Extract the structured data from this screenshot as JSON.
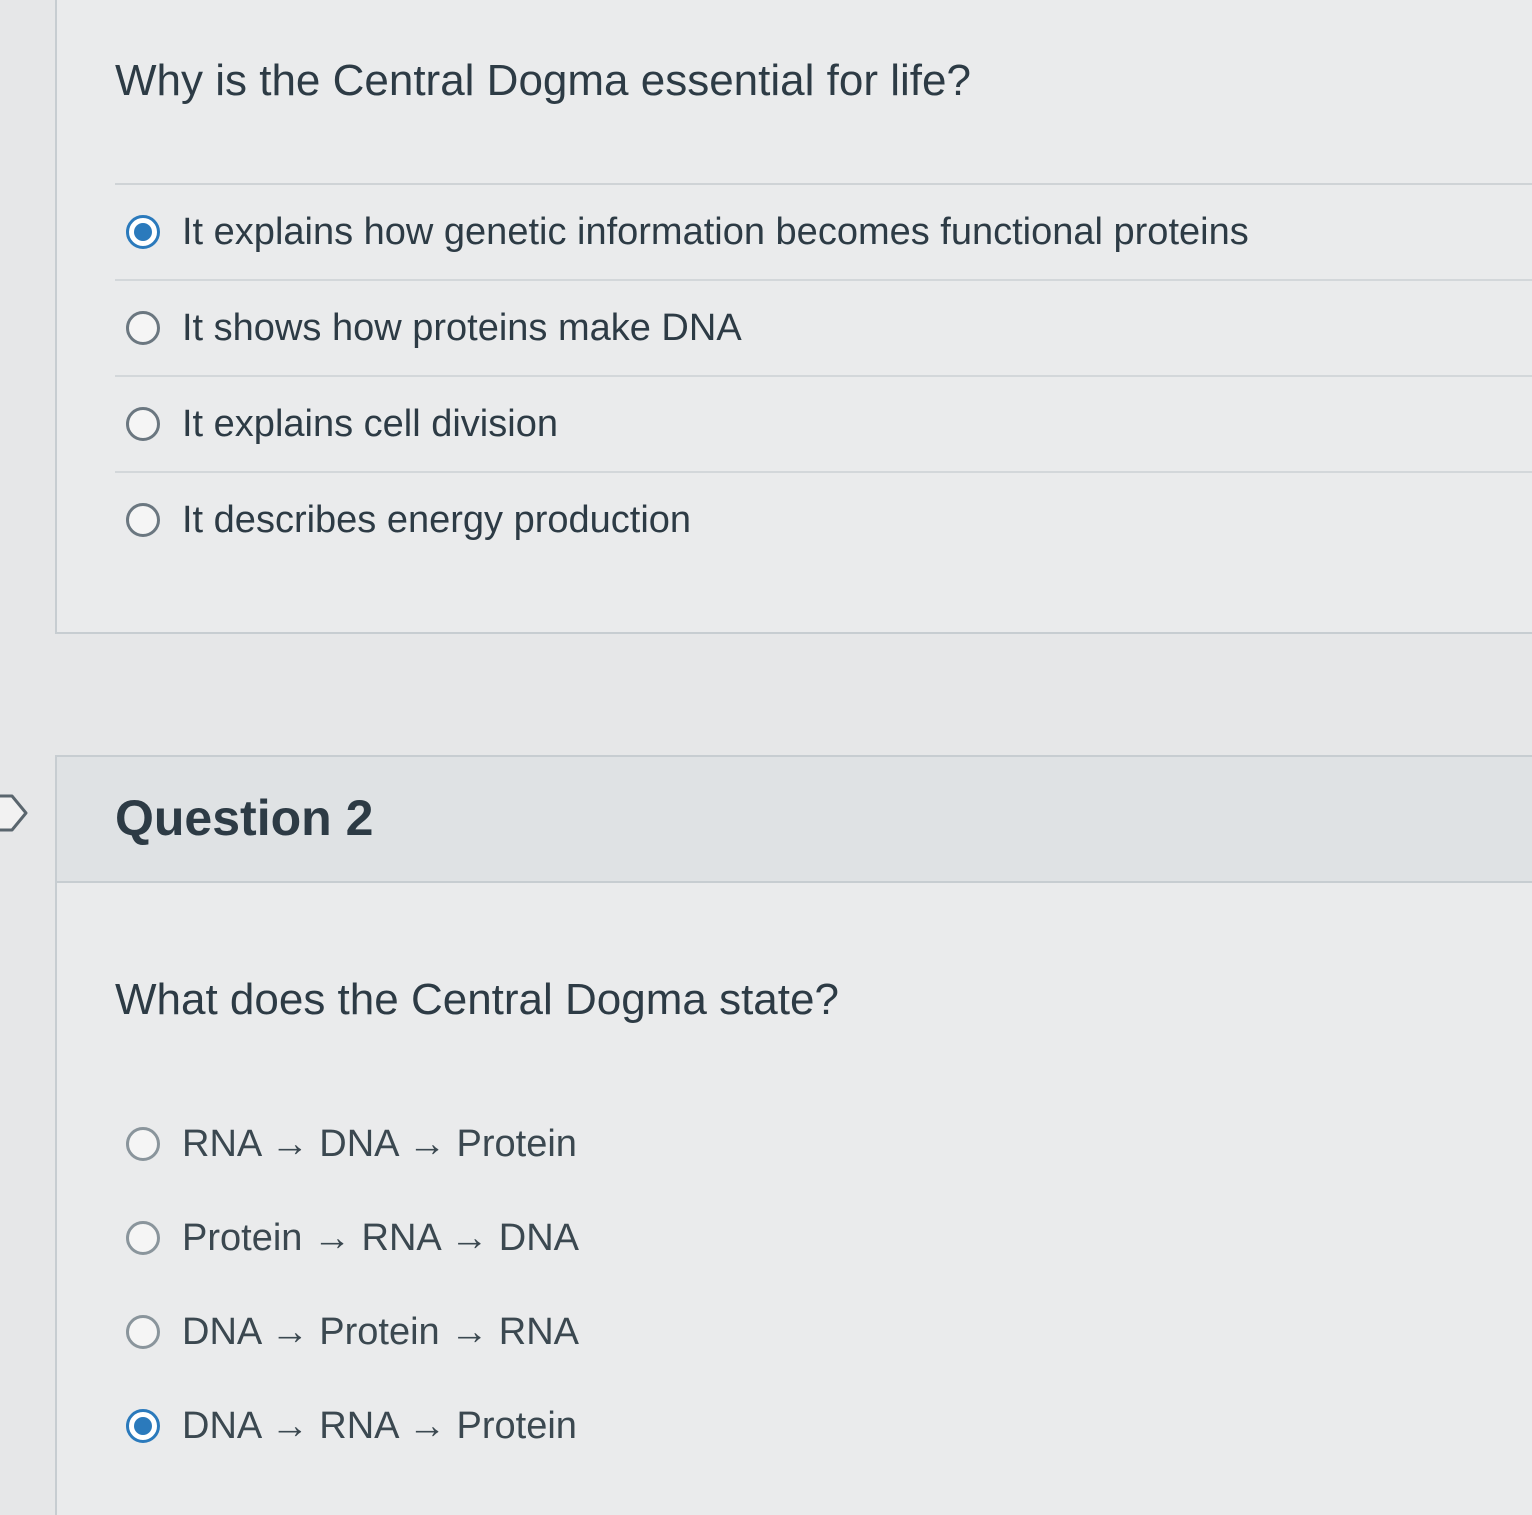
{
  "question1": {
    "text": "Why is the Central Dogma essential for life?",
    "answers": [
      {
        "label": "It explains how genetic information becomes functional proteins",
        "selected": true
      },
      {
        "label": "It shows how proteins make DNA",
        "selected": false
      },
      {
        "label": "It explains cell division",
        "selected": false
      },
      {
        "label": "It describes energy production",
        "selected": false
      }
    ]
  },
  "question2": {
    "title": "Question 2",
    "text": "What does the Central Dogma state?",
    "answers": [
      {
        "label": "RNA → DNA → Protein",
        "selected": false
      },
      {
        "label": "Protein → RNA → DNA",
        "selected": false
      },
      {
        "label": "DNA → Protein → RNA",
        "selected": false
      },
      {
        "label": "DNA → RNA → Protein",
        "selected": true
      }
    ]
  },
  "colors": {
    "accent": "#2b7abc",
    "text": "#2d3b45",
    "background": "#e6e7e8",
    "border": "#c7cdd1"
  },
  "icons": {
    "flag": "question-flag-icon"
  }
}
